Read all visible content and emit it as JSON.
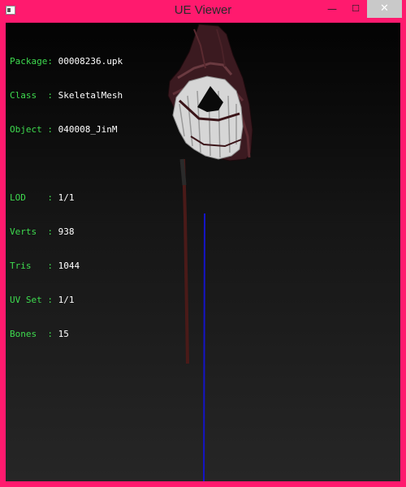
{
  "window": {
    "title": "UE Viewer",
    "icon": "app-icon",
    "controls": {
      "minimize": "—",
      "maximize": "☐",
      "close": "✕"
    }
  },
  "info": {
    "package": {
      "label": "Package:",
      "value": "00008236.upk"
    },
    "class": {
      "label": "Class  :",
      "value": "SkeletalMesh"
    },
    "object": {
      "label": "Object :",
      "value": "040008_JinM"
    },
    "lod": {
      "label": "LOD    :",
      "value": "1/1"
    },
    "verts": {
      "label": "Verts  :",
      "value": "938"
    },
    "tris": {
      "label": "Tris   :",
      "value": "1044"
    },
    "uvset": {
      "label": "UV Set :",
      "value": "1/1"
    },
    "bones": {
      "label": "Bones  :",
      "value": "15"
    }
  },
  "colors": {
    "frame": "#ff1a6e",
    "label": "#3edb4f",
    "value": "#ffffff",
    "axis": "#1414c8"
  }
}
